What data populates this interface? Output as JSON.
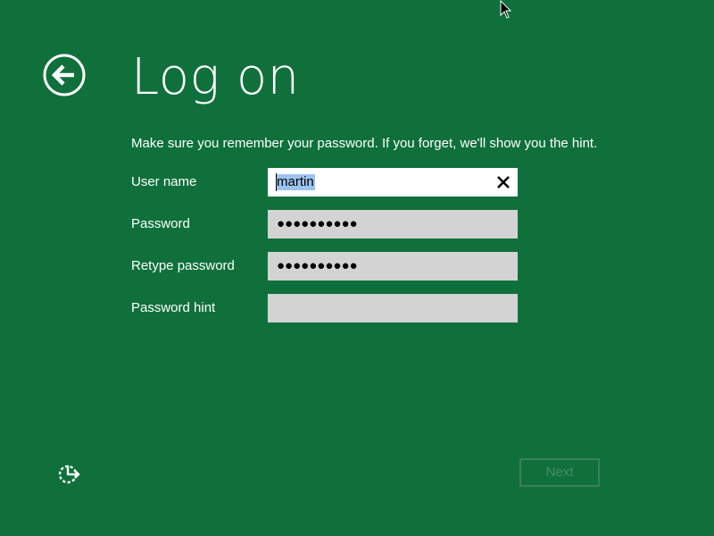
{
  "header": {
    "title": "Log on",
    "back_icon": "back-arrow-icon"
  },
  "instructions": "Make sure you remember your password. If you forget, we'll show you the hint.",
  "form": {
    "username": {
      "label": "User name",
      "value": "martin",
      "clear_icon": "close-icon"
    },
    "password": {
      "label": "Password",
      "value": "●●●●●●●●●●"
    },
    "retype_password": {
      "label": "Retype password",
      "value": "●●●●●●●●●●"
    },
    "password_hint": {
      "label": "Password hint",
      "value": ""
    }
  },
  "footer": {
    "ease_of_access_icon": "ease-of-access-icon",
    "next_label": "Next"
  },
  "colors": {
    "background": "#0f703b",
    "text": "#ffffff",
    "field_inactive": "#d3d3d3",
    "selection": "#9cc3ee",
    "next_disabled": "#4d8a69"
  }
}
